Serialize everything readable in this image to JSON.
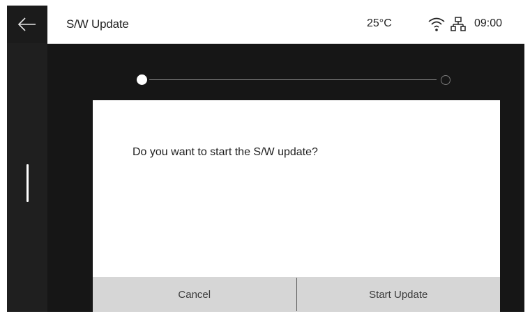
{
  "header": {
    "title": "S/W Update",
    "temperature": "25°C",
    "time": "09:00",
    "icons": [
      "back-arrow-icon",
      "wifi-icon",
      "network-icon"
    ]
  },
  "progress": {
    "current_step": 1,
    "total_steps": 2
  },
  "dialog": {
    "message": "Do you want to start the S/W update?",
    "cancel_label": "Cancel",
    "confirm_label": "Start Update"
  },
  "colors": {
    "screen_background": "#161616",
    "sidebar_background": "#1f1f1f",
    "dialog_background": "#ffffff",
    "button_bar": "#d6d6d6"
  }
}
